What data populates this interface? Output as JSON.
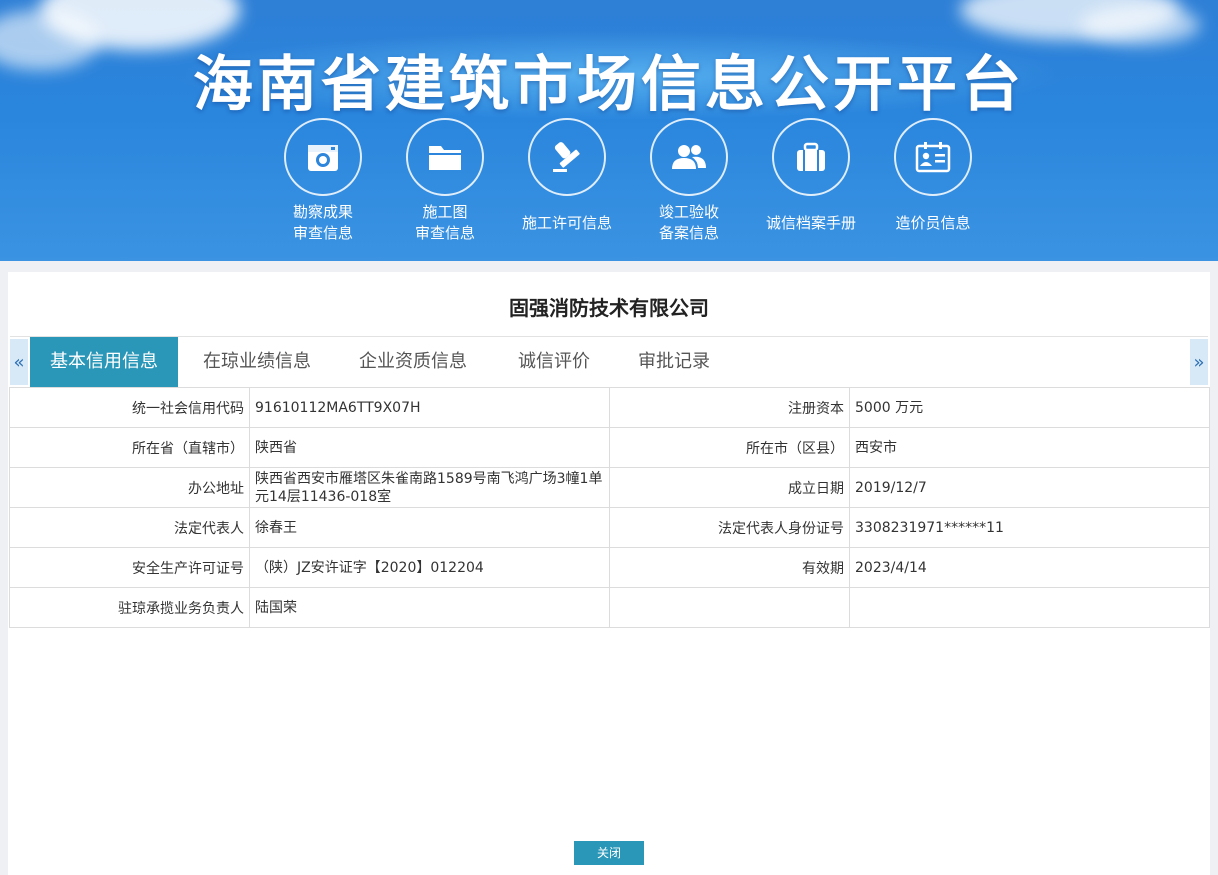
{
  "header": {
    "title": "海南省建筑市场信息公开平台",
    "nav": [
      {
        "label": "勘察成果\n审查信息",
        "icon": "camera-icon"
      },
      {
        "label": "施工图\n审查信息",
        "icon": "folder-icon"
      },
      {
        "label": "施工许可信息",
        "icon": "stamp-icon"
      },
      {
        "label": "竣工验收\n备案信息",
        "icon": "users-icon"
      },
      {
        "label": "诚信档案手册",
        "icon": "briefcase-icon"
      },
      {
        "label": "造价员信息",
        "icon": "id-card-icon"
      }
    ]
  },
  "company": {
    "name": "固强消防技术有限公司"
  },
  "tabs": {
    "prev": "«",
    "next": "»",
    "items": [
      "基本信用信息",
      "在琼业绩信息",
      "企业资质信息",
      "诚信评价",
      "审批记录"
    ],
    "active_index": 0
  },
  "info": {
    "rows": [
      {
        "l1": "统一社会信用代码",
        "v1": " 91610112MA6TT9X07H",
        "l2": "注册资本",
        "v2": "5000 万元"
      },
      {
        "l1": "所在省（直辖市）",
        "v1": "陕西省",
        "l2": "所在市（区县）",
        "v2": "西安市"
      },
      {
        "l1": "办公地址",
        "v1": "陕西省西安市雁塔区朱雀南路1589号南飞鸿广场3幢1单元14层11436-018室",
        "l2": "成立日期",
        "v2": "2019/12/7"
      },
      {
        "l1": "法定代表人",
        "v1": "徐春王",
        "l2": "法定代表人身份证号",
        "v2": "3308231971******11"
      },
      {
        "l1": "安全生产许可证号",
        "v1": "（陕）JZ安许证字【2020】012204",
        "l2": "有效期",
        "v2": "2023/4/14"
      },
      {
        "l1": "驻琼承揽业务负责人",
        "v1": "陆国荣",
        "l2": "",
        "v2": ""
      }
    ]
  },
  "footer": {
    "close_label": "关闭"
  },
  "colors": {
    "accent": "#2a97b8",
    "banner": "#2a86dd"
  }
}
